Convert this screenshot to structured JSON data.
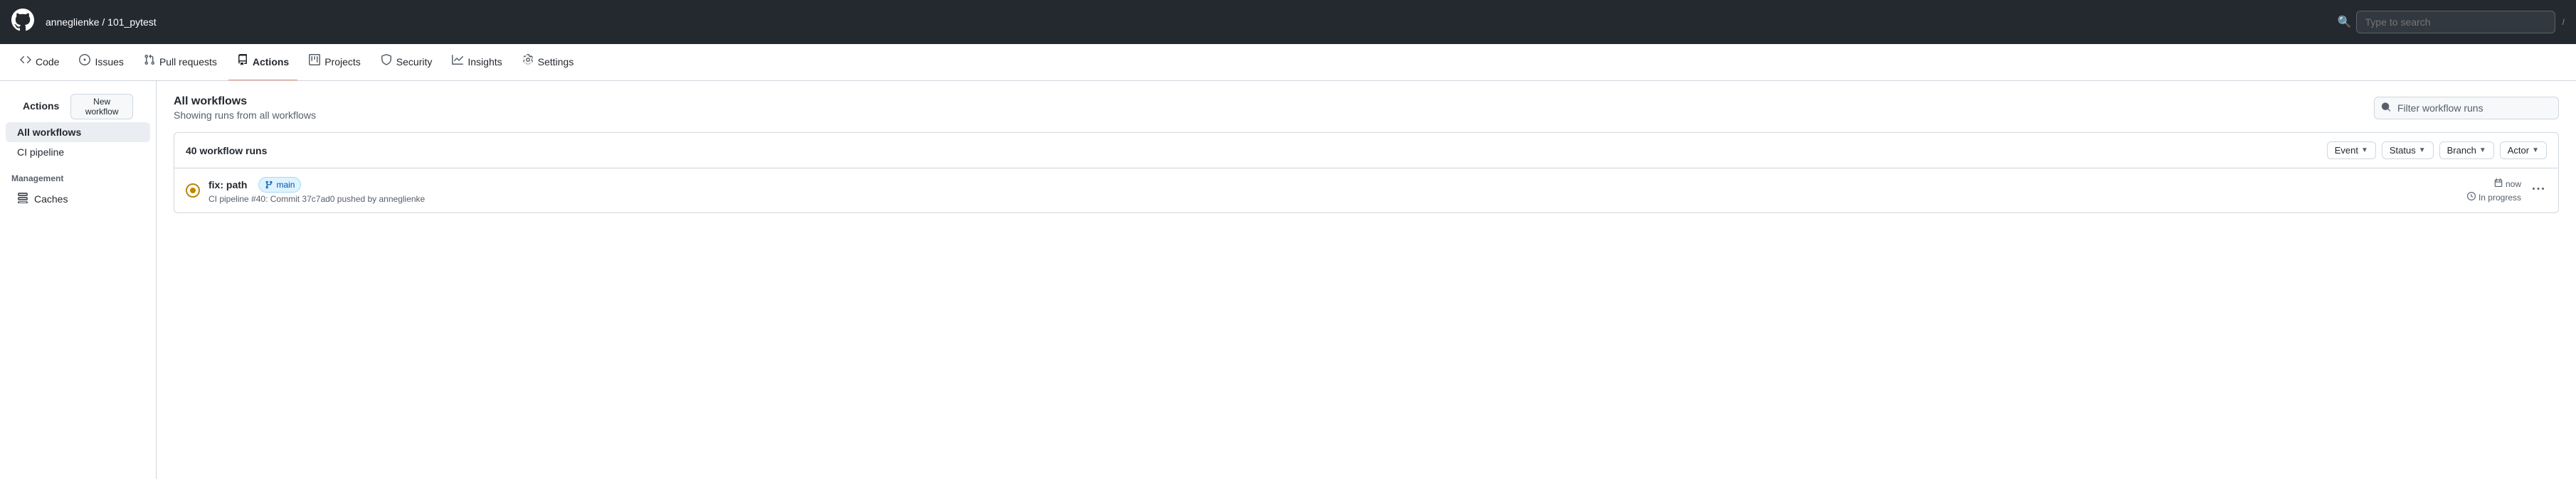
{
  "topNav": {
    "logo": "⬡",
    "user": "anneglienke / 101_pytest",
    "search_placeholder": "Type to search",
    "search_shortcut": "/"
  },
  "repoNav": {
    "items": [
      {
        "id": "code",
        "label": "Code",
        "icon": "◧"
      },
      {
        "id": "issues",
        "label": "Issues",
        "icon": "ⓘ"
      },
      {
        "id": "pull-requests",
        "label": "Pull requests",
        "icon": "⇄"
      },
      {
        "id": "actions",
        "label": "Actions",
        "icon": "▶",
        "active": true
      },
      {
        "id": "projects",
        "label": "Projects",
        "icon": "⊞"
      },
      {
        "id": "security",
        "label": "Security",
        "icon": "🛡"
      },
      {
        "id": "insights",
        "label": "Insights",
        "icon": "📈"
      },
      {
        "id": "settings",
        "label": "Settings",
        "icon": "⚙"
      }
    ]
  },
  "sidebar": {
    "header": "Actions",
    "new_workflow_label": "New workflow",
    "items": [
      {
        "id": "all-workflows",
        "label": "All workflows",
        "active": true
      },
      {
        "id": "ci-pipeline",
        "label": "CI pipeline",
        "active": false
      }
    ],
    "management_label": "Management",
    "management_items": [
      {
        "id": "caches",
        "label": "Caches",
        "icon": "◫"
      }
    ]
  },
  "content": {
    "title": "All workflows",
    "subtitle": "Showing runs from all workflows",
    "filter_placeholder": "Filter workflow runs"
  },
  "runsHeader": {
    "count_label": "40 workflow runs",
    "filters": [
      {
        "id": "event-filter",
        "label": "Event",
        "has_chevron": true
      },
      {
        "id": "status-filter",
        "label": "Status",
        "has_chevron": true
      },
      {
        "id": "branch-filter",
        "label": "Branch",
        "has_chevron": true
      },
      {
        "id": "actor-filter",
        "label": "Actor",
        "has_chevron": true
      }
    ]
  },
  "runs": [
    {
      "id": "run-1",
      "title": "fix: path",
      "workflow": "CI pipeline",
      "commit_ref": "#40",
      "commit_msg": "Commit 37c7ad0 pushed by anneglienke",
      "branch": "main",
      "time_label": "now",
      "duration_label": "In progress",
      "status": "in_progress"
    }
  ],
  "icons": {
    "search": "🔍",
    "calendar": "📅",
    "clock": "⏱",
    "branch": "⎇",
    "more": "···"
  }
}
